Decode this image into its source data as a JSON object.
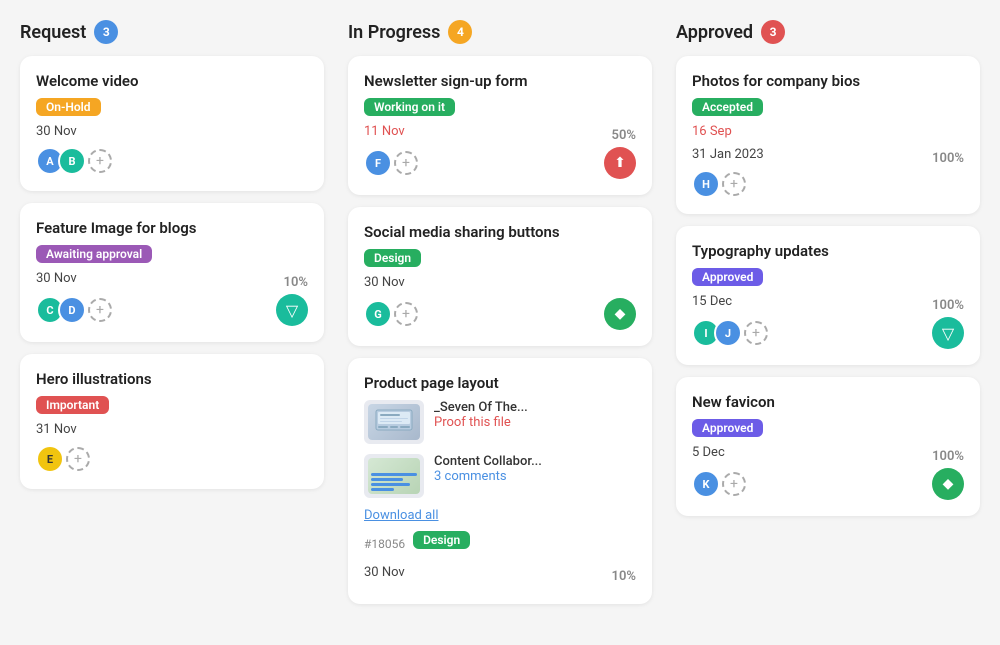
{
  "columns": [
    {
      "id": "request",
      "title": "Request",
      "badge": "3",
      "badge_color": "badge-blue",
      "cards": [
        {
          "id": "c1",
          "title": "Welcome video",
          "tag": "On-Hold",
          "tag_class": "tag-orange",
          "date": "30 Nov",
          "date_class": "card-date-black",
          "avatars": [
            {
              "initials": "A",
              "color": "avatar-blue"
            },
            {
              "initials": "B",
              "color": "avatar-teal"
            }
          ],
          "show_plus": true,
          "percent": null,
          "icon": null
        },
        {
          "id": "c2",
          "title": "Feature Image for blogs",
          "tag": "Awaiting approval",
          "tag_class": "tag-purple",
          "date": "30 Nov",
          "date_class": "card-date-black",
          "avatars": [
            {
              "initials": "C",
              "color": "avatar-teal"
            },
            {
              "initials": "D",
              "color": "avatar-blue"
            }
          ],
          "show_plus": true,
          "percent": "10%",
          "icon": "▽",
          "icon_class": "icon-teal"
        },
        {
          "id": "c3",
          "title": "Hero illustrations",
          "tag": "Important",
          "tag_class": "tag-red",
          "date": "31 Nov",
          "date_class": "card-date-black",
          "avatars": [
            {
              "initials": "E",
              "color": "avatar-yellow"
            }
          ],
          "show_plus": true,
          "percent": null,
          "icon": null
        }
      ]
    },
    {
      "id": "inprogress",
      "title": "In Progress",
      "badge": "4",
      "badge_color": "badge-yellow",
      "cards": [
        {
          "id": "c4",
          "title": "Newsletter sign-up form",
          "tag": "Working on it",
          "tag_class": "tag-working",
          "date": "11 Nov",
          "date_class": "card-date",
          "avatars": [
            {
              "initials": "F",
              "color": "avatar-blue"
            }
          ],
          "show_plus": true,
          "percent": "50%",
          "icon": "⬆",
          "icon_class": "icon-red"
        },
        {
          "id": "c5",
          "title": "Social media sharing buttons",
          "tag": "Design",
          "tag_class": "tag-design",
          "date": "30 Nov",
          "date_class": "card-date-black",
          "avatars": [
            {
              "initials": "G",
              "color": "avatar-teal"
            }
          ],
          "show_plus": true,
          "percent": null,
          "icon": "◆",
          "icon_class": "icon-green"
        },
        {
          "id": "c6",
          "title": "Product page layout",
          "files": [
            {
              "name": "_Seven Of The...",
              "action": "Proof this file",
              "type": "screen"
            },
            {
              "name": "Content Collabor...",
              "action": "3 comments",
              "type": "chart"
            }
          ],
          "download_link": "Download all",
          "issue_id": "#18056",
          "tag": "Design",
          "tag_class": "tag-design",
          "date": "30 Nov",
          "date_class": "card-date-black",
          "percent": "10%",
          "icon": null
        }
      ]
    },
    {
      "id": "approved",
      "title": "Approved",
      "badge": "3",
      "badge_color": "badge-red",
      "cards": [
        {
          "id": "c7",
          "title": "Photos for company bios",
          "tag": "Accepted",
          "tag_class": "tag-accepted",
          "date": "16 Sep",
          "date_class": "card-date",
          "date2": "31 Jan 2023",
          "avatars": [
            {
              "initials": "H",
              "color": "avatar-blue"
            }
          ],
          "show_plus": true,
          "percent": "100%",
          "icon": null
        },
        {
          "id": "c8",
          "title": "Typography updates",
          "tag": "Approved",
          "tag_class": "tag-approved",
          "date": "15 Dec",
          "date_class": "card-date-black",
          "avatars": [
            {
              "initials": "I",
              "color": "avatar-teal"
            },
            {
              "initials": "J",
              "color": "avatar-blue"
            }
          ],
          "show_plus": true,
          "percent": "100%",
          "icon": "▽",
          "icon_class": "icon-teal"
        },
        {
          "id": "c9",
          "title": "New favicon",
          "tag": "Approved",
          "tag_class": "tag-approved",
          "date": "5 Dec",
          "date_class": "card-date-black",
          "avatars": [
            {
              "initials": "K",
              "color": "avatar-blue"
            }
          ],
          "show_plus": true,
          "percent": "100%",
          "icon": "◆",
          "icon_class": "icon-green"
        }
      ]
    }
  ]
}
